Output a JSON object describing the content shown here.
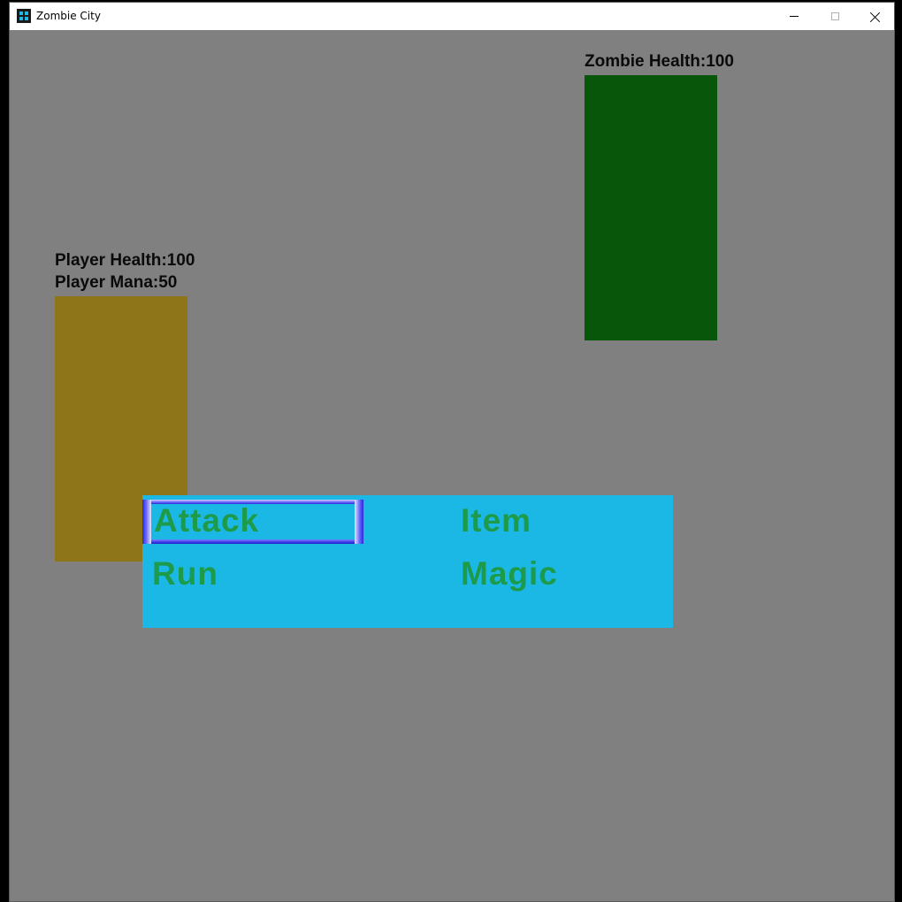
{
  "window": {
    "title": "Zombie City",
    "icon": "app-icon"
  },
  "hud": {
    "zombie_health_text": "Zombie Health:100",
    "player_health_text": "Player Health:100",
    "player_mana_text": "Player Mana:50"
  },
  "stats": {
    "zombie_health": 100,
    "player_health": 100,
    "player_mana": 50
  },
  "battle_menu": {
    "options": [
      {
        "label": "Attack",
        "selected": true
      },
      {
        "label": "Item",
        "selected": false
      },
      {
        "label": "Run",
        "selected": false
      },
      {
        "label": "Magic",
        "selected": false
      }
    ]
  },
  "colors": {
    "background": "#808080",
    "zombie": "#07560a",
    "player": "#8e7519",
    "menu_background": "#1bb8e6",
    "menu_text": "#1d9b4a",
    "selector": "#3c3cf0"
  }
}
